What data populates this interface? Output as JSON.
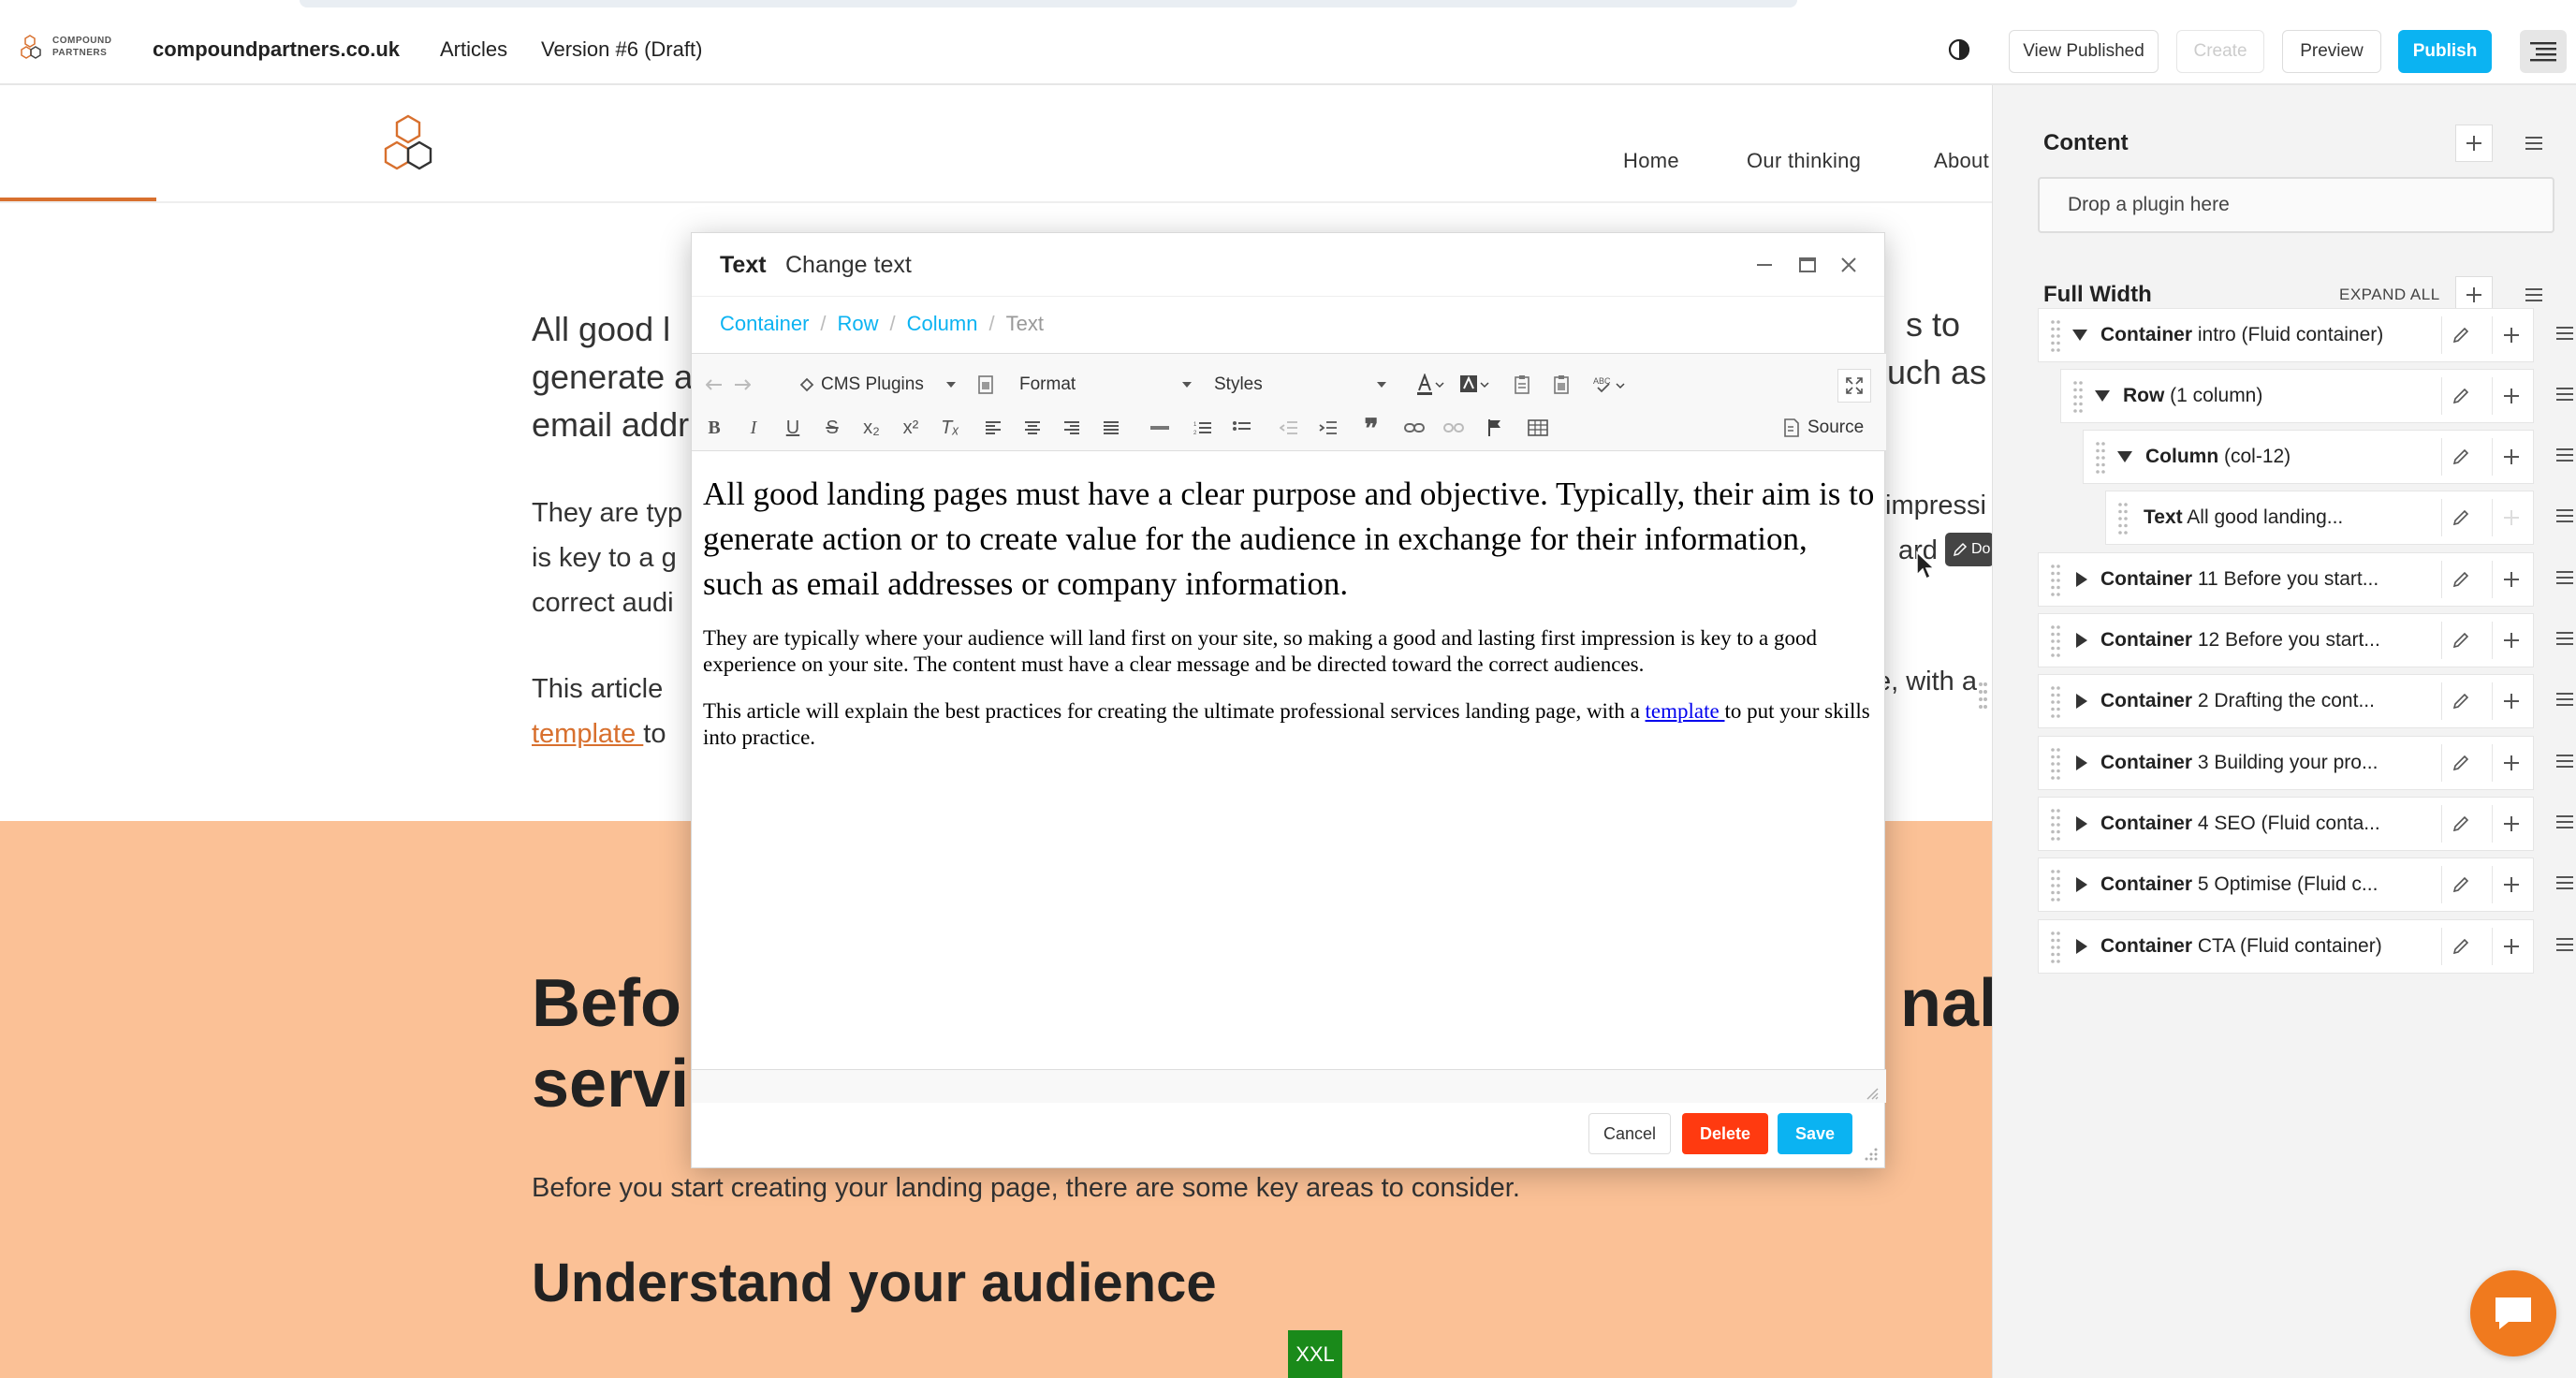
{
  "toolbar": {
    "logo_line1": "COMPOUND",
    "logo_line2": "PARTNERS",
    "site": "compoundpartners.co.uk",
    "articles": "Articles",
    "version": "Version #6 (Draft)",
    "view_published": "View Published",
    "create": "Create",
    "preview": "Preview",
    "publish": "Publish"
  },
  "site": {
    "nav": [
      "Home",
      "Our thinking",
      "About"
    ],
    "intro_lines": [
      "All good l",
      "generate a",
      "email addr"
    ],
    "intro_right": [
      "s to",
      "uch as"
    ],
    "p2_lines": [
      "They are typ",
      "is key to a g",
      "correct audi"
    ],
    "p2_right": [
      "impressi",
      "ard the"
    ],
    "p3_line1": "This article",
    "p3_right": "e, with a",
    "p3_link": "template ",
    "p3_after": "to",
    "band_heading": [
      "Befo",
      "servi"
    ],
    "band_heading_right": "nal",
    "band_text": "Before you start creating your landing page, there are some key areas to consider.",
    "band_h2": "Understand your audience",
    "breakpoint_badge": "XXL",
    "edit_tag": "Do"
  },
  "modal": {
    "title": "Text",
    "subtitle": "Change text",
    "breadcrumb": [
      "Container",
      "Row",
      "Column"
    ],
    "breadcrumb_current": "Text",
    "toolbar": {
      "cms_plugins": "CMS Plugins",
      "format": "Format",
      "styles": "Styles",
      "source": "Source"
    },
    "content": {
      "p1": "All good landing pages must have a clear purpose and objective. Typically, their aim is to generate action or to create value for the audience in exchange for their information, such as email addresses or company information.",
      "p2": "They are typically where your audience will land first on your site, so making a good and lasting first impression is key to a good experience on your site. The content must have a clear message and be directed toward the correct audiences.",
      "p3_before": "This article will explain the best practices for creating the ultimate professional services landing page, with a ",
      "p3_link": "template ",
      "p3_after": "to put your skills into practice."
    },
    "buttons": {
      "cancel": "Cancel",
      "delete": "Delete",
      "save": "Save"
    }
  },
  "sidebar": {
    "content_heading": "Content",
    "drop_placeholder": "Drop a plugin here",
    "fullwidth_heading": "Full Width",
    "expand_all": "EXPAND ALL",
    "tree": [
      {
        "bold": "Container",
        "rest": " intro (Fluid container)"
      },
      {
        "bold": "Row",
        "rest": " (1 column)"
      },
      {
        "bold": "Column",
        "rest": " (col-12)"
      },
      {
        "bold": "Text",
        "rest": " All good landing..."
      },
      {
        "bold": "Container",
        "rest": " 11 Before you start..."
      },
      {
        "bold": "Container",
        "rest": " 12 Before you start..."
      },
      {
        "bold": "Container",
        "rest": " 2 Drafting the cont..."
      },
      {
        "bold": "Container",
        "rest": " 3 Building your pro..."
      },
      {
        "bold": "Container",
        "rest": " 4 SEO (Fluid conta..."
      },
      {
        "bold": "Container",
        "rest": " 5 Optimise (Fluid c..."
      },
      {
        "bold": "Container",
        "rest": " CTA (Fluid container)"
      }
    ]
  },
  "colors": {
    "accent_blue": "#0bb3f2",
    "delete_red": "#ff3a10",
    "brand_orange": "#d8702e",
    "band_peach": "#fbc196",
    "chat_orange": "#f07a1e"
  }
}
